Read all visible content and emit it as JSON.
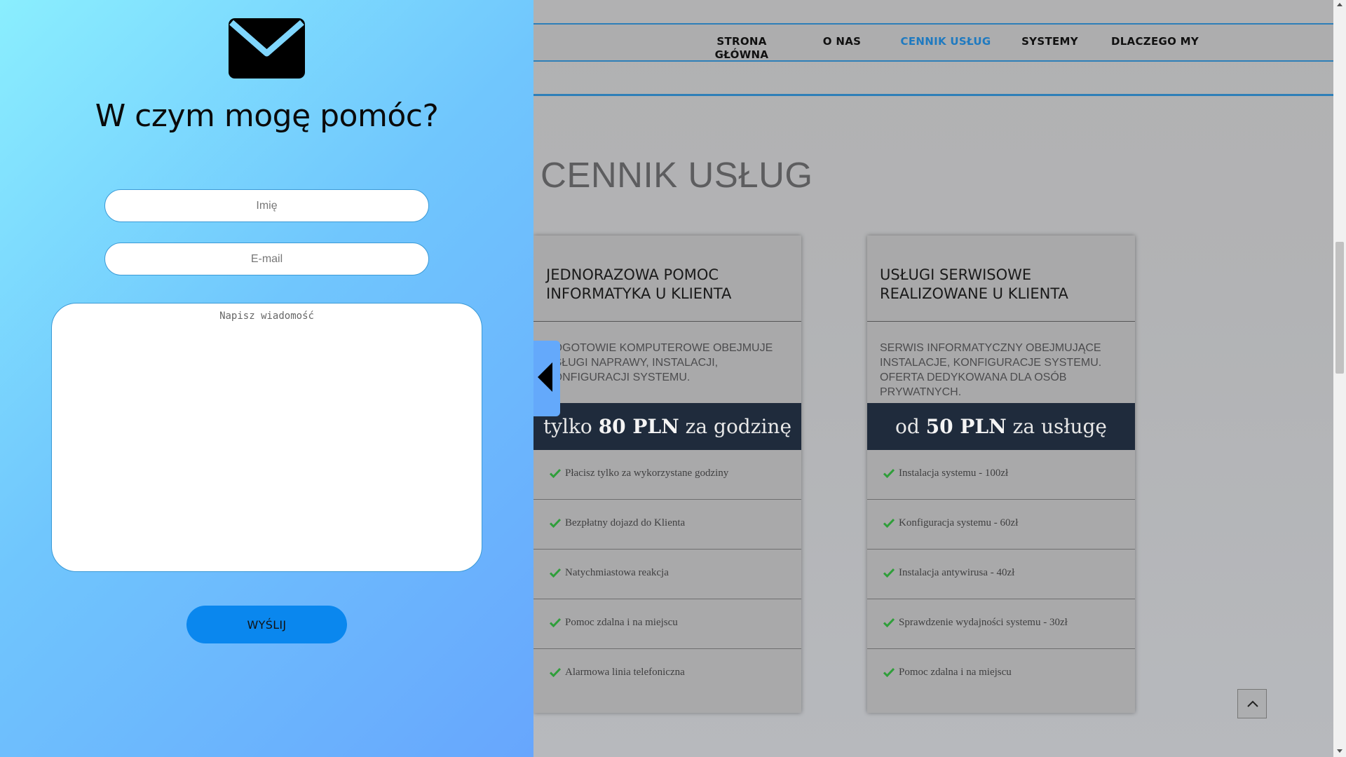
{
  "nav": {
    "items": [
      {
        "label": "STRONA GŁÓWNA",
        "active": false
      },
      {
        "label": "O NAS",
        "active": false
      },
      {
        "label": "CENNIK USŁUG",
        "active": true
      },
      {
        "label": "SYSTEMY",
        "active": false
      },
      {
        "label": "DLACZEGO MY",
        "active": false
      }
    ]
  },
  "page": {
    "heading": "CENNIK USŁUG"
  },
  "cards": [
    {
      "title": "JEDNORAZOWA POMOC INFORMATYKA U KLIENTA",
      "description": "POGOTOWIE KOMPUTEROWE OBEJMUJE USŁUGI NAPRAWY, INSTALACJI, KONFIGURACJI SYSTEMU.",
      "price_prefix": "tylko",
      "price_value": "80 PLN",
      "price_suffix": "za godzinę",
      "features": [
        "Płacisz tylko za wykorzystane godziny",
        "Bezpłatny dojazd do Klienta",
        "Natychmiastowa reakcja",
        "Pomoc zdalna i na miejscu",
        "Alarmowa linia telefoniczna"
      ]
    },
    {
      "title": "USŁUGI SERWISOWE REALIZOWANE U KLIENTA",
      "description": "SERWIS INFORMATYCZNY OBEJMUJĄCE INSTALACJE, KONFIGURACJE SYSTEMU. OFERTA DEDYKOWANA DLA OSÓB PRYWATNYCH.",
      "price_prefix": "od",
      "price_value": "50 PLN",
      "price_suffix": "za usługę",
      "features": [
        "Instalacja systemu - 100zł",
        "Konfiguracja systemu - 60zł",
        "Instalacja antywirusa - 40zł",
        "Sprawdzenie wydajności systemu - 30zł",
        "Pomoc zdalna i na miejscu"
      ]
    }
  ],
  "contact": {
    "title": "W czym mogę pomóc?",
    "name_placeholder": "Imię",
    "email_placeholder": "E-mail",
    "message_placeholder": "Napisz wiadomość",
    "send_label": "WYŚLIJ",
    "icon": "envelope-icon"
  },
  "icons": {
    "check": "check-icon",
    "toggle": "caret-left-icon",
    "scroll_top": "chevron-up-icon"
  },
  "colors": {
    "accent": "#2e7fb8",
    "nav_active": "#1f7ac0",
    "price_band": "#1f2b3c",
    "check": "#2f9e3a",
    "send_button": "#0a87ee",
    "panel_gradient_start": "#8aeefe",
    "panel_gradient_end": "#67a6fd"
  }
}
